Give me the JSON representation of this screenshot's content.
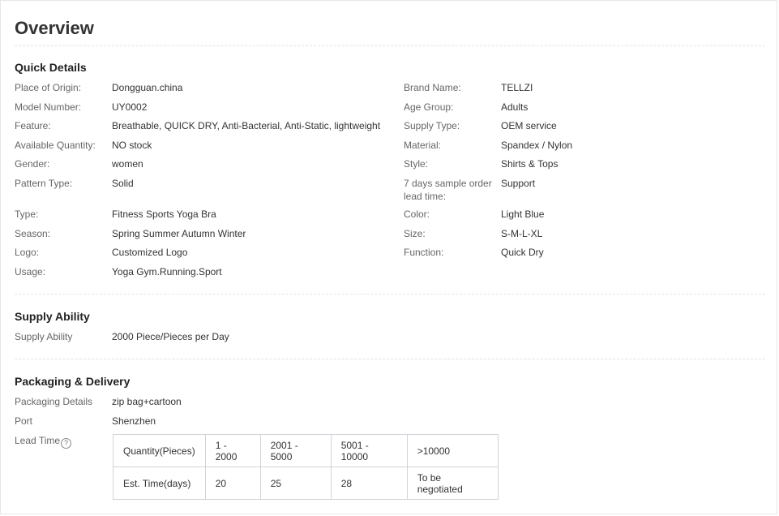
{
  "title": "Overview",
  "quick_details": {
    "heading": "Quick Details",
    "left": [
      {
        "label": "Place of Origin:",
        "value": "Dongguan.china"
      },
      {
        "label": "Model Number:",
        "value": "UY0002"
      },
      {
        "label": "Feature:",
        "value": "Breathable, QUICK DRY, Anti-Bacterial, Anti-Static, lightweight"
      },
      {
        "label": "Available Quantity:",
        "value": "NO stock"
      },
      {
        "label": "Gender:",
        "value": "women"
      },
      {
        "label": "Pattern Type:",
        "value": "Solid"
      },
      {
        "label": "Type:",
        "value": "Fitness Sports Yoga Bra"
      },
      {
        "label": "Season:",
        "value": "Spring Summer Autumn Winter"
      },
      {
        "label": "Logo:",
        "value": "Customized Logo"
      },
      {
        "label": "Usage:",
        "value": "Yoga Gym.Running.Sport"
      }
    ],
    "right": [
      {
        "label": "Brand Name:",
        "value": "TELLZI"
      },
      {
        "label": "Age Group:",
        "value": "Adults"
      },
      {
        "label": "Supply Type:",
        "value": "OEM service"
      },
      {
        "label": "Material:",
        "value": "Spandex / Nylon"
      },
      {
        "label": "Style:",
        "value": "Shirts & Tops"
      },
      {
        "label": "7 days sample order lead time:",
        "value": "Support"
      },
      {
        "label": "Color:",
        "value": "Light Blue"
      },
      {
        "label": "Size:",
        "value": "S-M-L-XL"
      },
      {
        "label": "Function:",
        "value": "Quick Dry"
      }
    ]
  },
  "supply_ability": {
    "heading": "Supply Ability",
    "label": "Supply Ability",
    "value": "2000 Piece/Pieces per Day"
  },
  "packaging": {
    "heading": "Packaging & Delivery",
    "details_label": "Packaging Details",
    "details_value": "zip bag+cartoon",
    "port_label": "Port",
    "port_value": "Shenzhen",
    "lead_time_label": "Lead Time",
    "help_icon": "question-circle-icon",
    "help_glyph": "?",
    "lead_table": {
      "quantity_header": "Quantity(Pieces)",
      "quantities": [
        "1 - 2000",
        "2001 - 5000",
        "5001 - 10000",
        ">10000"
      ],
      "time_header": "Est. Time(days)",
      "times": [
        "20",
        "25",
        "28",
        "To be negotiated"
      ]
    }
  }
}
